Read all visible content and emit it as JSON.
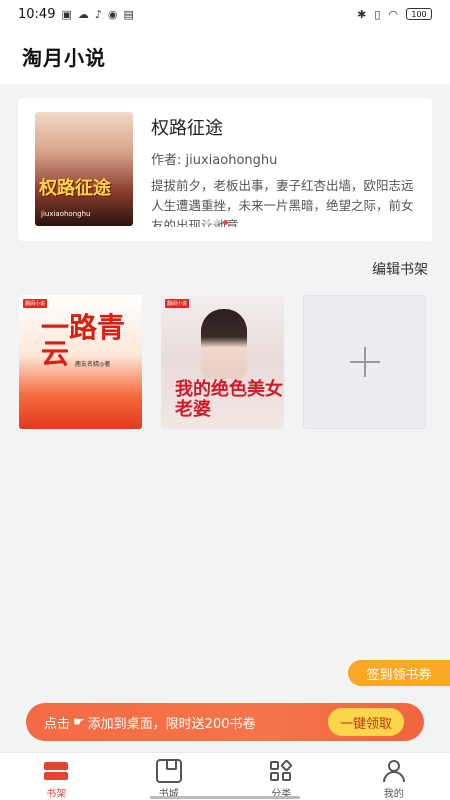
{
  "status_bar": {
    "time": "10:49",
    "battery": "100"
  },
  "app": {
    "title": "淘月小说"
  },
  "featured": {
    "cover_title": "权路征途",
    "cover_author": "jiuxiaohonghu",
    "title": "权路征途",
    "author": "作者: jiuxiaohonghu",
    "description": "提拔前夕，老板出事，妻子红杏出墙，欧阳志远人生遭遇重挫，未来一片黑暗，绝望之际，前女友的出现让他意..."
  },
  "shelf": {
    "edit_label": "编辑书架",
    "books": [
      {
        "cover_title": "一路青云",
        "cover_author": "鹿友名婧◎著",
        "brand": "翻阅小说"
      },
      {
        "cover_title": "我的绝色美女老婆",
        "brand": "翻阅小说"
      }
    ]
  },
  "checkin": {
    "label": "签到领书券"
  },
  "promo": {
    "text_before": "点击",
    "text_after": "添加到桌面，限时送200书卷",
    "button": "一键领取"
  },
  "tabs": [
    {
      "label": "书架",
      "icon": "bookshelf-icon",
      "active": true
    },
    {
      "label": "书城",
      "icon": "bookstore-icon",
      "active": false
    },
    {
      "label": "分类",
      "icon": "category-icon",
      "active": false
    },
    {
      "label": "我的",
      "icon": "profile-icon",
      "active": false
    }
  ],
  "colors": {
    "accent": "#e8432f",
    "promo": "#f46a45",
    "checkin": "#f9a825",
    "claim_button": "#fbd64a"
  }
}
